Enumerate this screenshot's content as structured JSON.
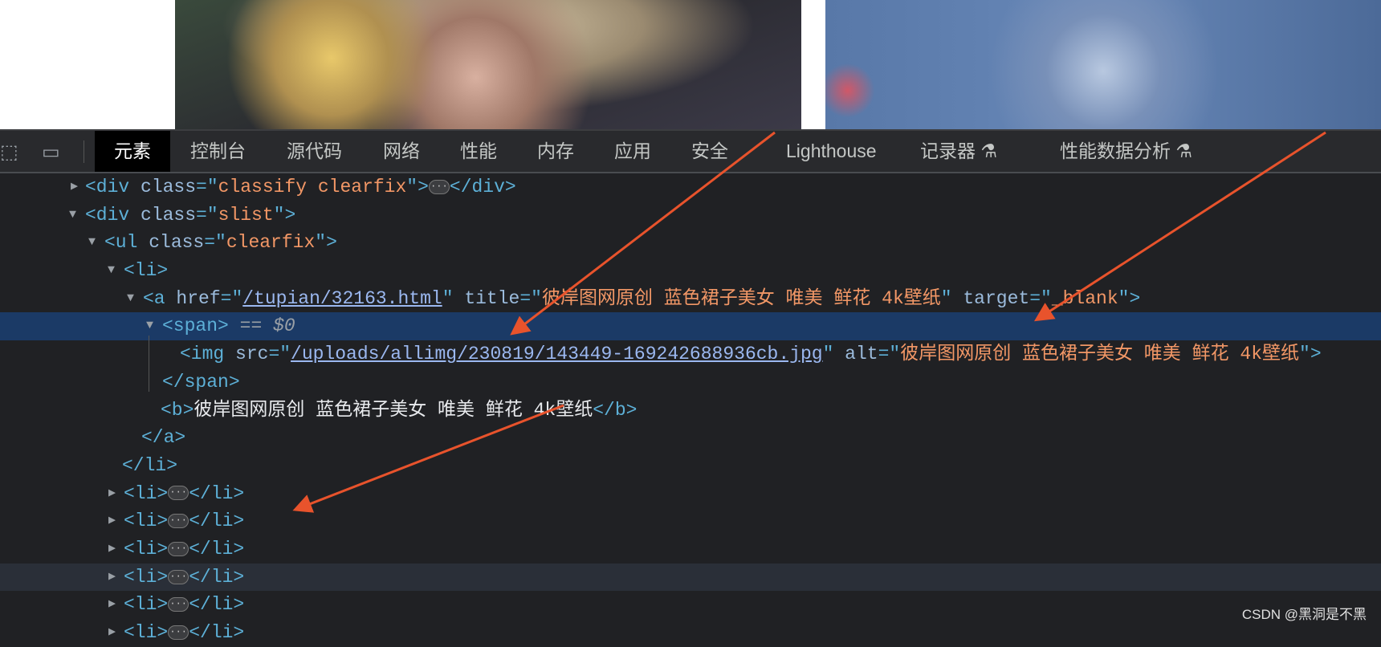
{
  "devtools": {
    "tabs": [
      "元素",
      "控制台",
      "源代码",
      "网络",
      "性能",
      "内存",
      "应用",
      "安全",
      "Lighthouse",
      "记录器",
      "性能数据分析"
    ],
    "active_tab": "元素",
    "experimental_icon": "flask-icon"
  },
  "tree": {
    "classify_class": "classify clearfix",
    "slist_class": "slist",
    "ul_class": "clearfix",
    "a_href": "/tupian/32163.html",
    "a_title": "彼岸图网原创 蓝色裙子美女 唯美 鲜花 4k壁纸",
    "a_target": "_blank",
    "selected_marker": "== $0",
    "img_src": "/uploads/allimg/230819/143449-169242688936cb.jpg",
    "img_alt": "彼岸图网原创 蓝色裙子美女 唯美 鲜花 4k壁纸",
    "b_text": "彼岸图网原创 蓝色裙子美女 唯美 鲜花 4k壁纸",
    "collapsed_li_count": 6
  },
  "annotation_color": "#e8532c",
  "watermark": "CSDN @黑洞是不黑"
}
